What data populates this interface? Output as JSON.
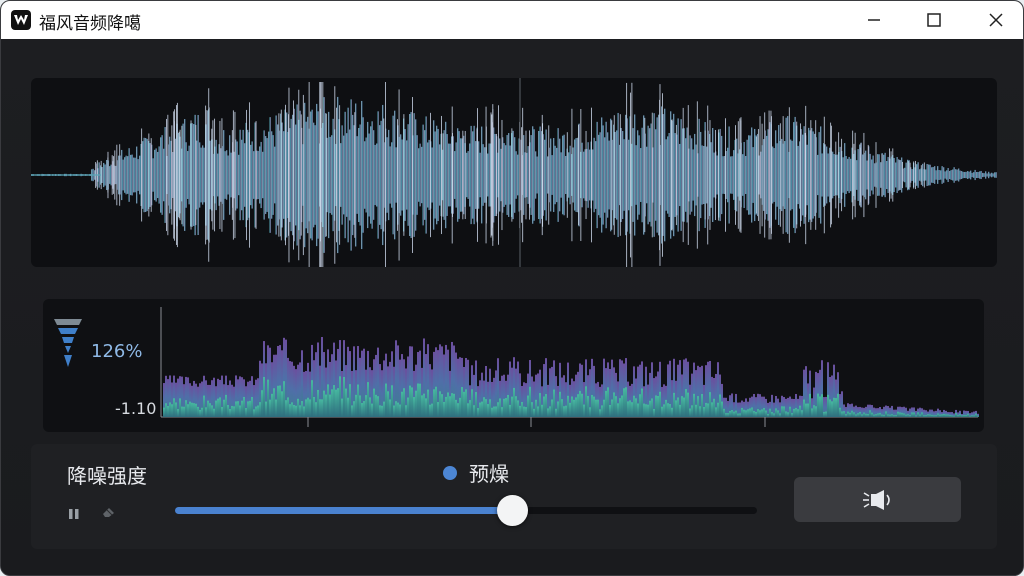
{
  "window": {
    "title": "福风音频降噶",
    "minimize_icon": "minimize-icon",
    "maximize_icon": "maximize-icon",
    "close_icon": "close-icon"
  },
  "spectrum": {
    "level_label": "126%",
    "floor_label": "-1.10",
    "icon": "funnel-meter-icon"
  },
  "controls": {
    "noise_reduction_label": "降噪强度",
    "preset_label": "预燥",
    "strength": 0.58,
    "action_icon": "speaker-broadcast-icon",
    "pause_icon": "pause-icon",
    "eraser_icon": "eraser-icon"
  },
  "colors": {
    "accent": "#4a82d0",
    "wave_blue": "#5b8fd6",
    "wave_teal": "#5aa7a0"
  }
}
